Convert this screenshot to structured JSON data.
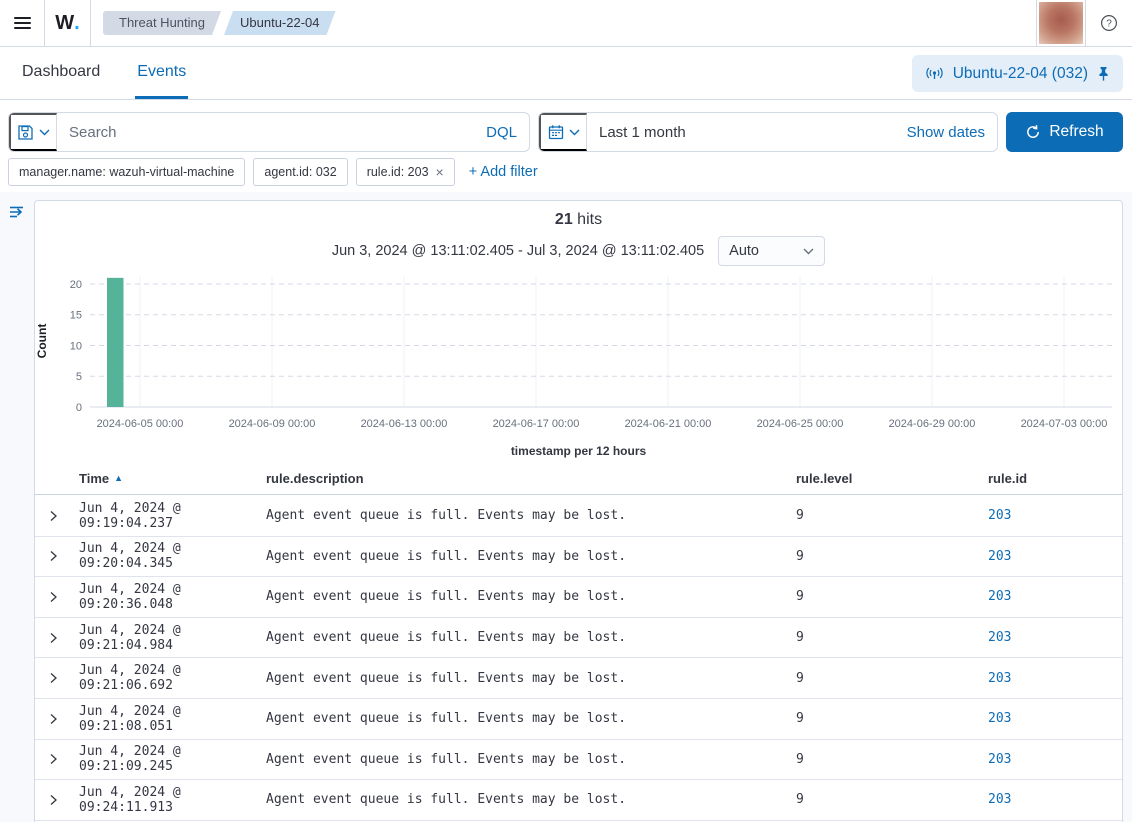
{
  "topbar": {
    "logo_text": "W",
    "logo_dot": ".",
    "breadcrumbs": [
      {
        "label": "Threat Hunting"
      },
      {
        "label": "Ubuntu-22-04"
      }
    ]
  },
  "tabs": [
    {
      "label": "Dashboard",
      "active": false
    },
    {
      "label": "Events",
      "active": true
    }
  ],
  "agent_chip": {
    "label": "Ubuntu-22-04 (032)"
  },
  "query_bar": {
    "search_placeholder": "Search",
    "search_value": "",
    "language_label": "DQL",
    "date_value": "Last 1 month",
    "show_dates_label": "Show dates",
    "refresh_label": "Refresh"
  },
  "filters": {
    "pills": [
      {
        "label": "manager.name: wazuh-virtual-machine",
        "close": ""
      },
      {
        "label": "agent.id: 032",
        "close": ""
      },
      {
        "label": "rule.id: 203",
        "close": "×"
      }
    ],
    "add_filter_label": "+ Add filter"
  },
  "hits": {
    "count": "21",
    "label": "hits"
  },
  "time_range": {
    "text": "Jun 3, 2024 @ 13:11:02.405 - Jul 3, 2024 @ 13:11:02.405",
    "interval_selected": "Auto"
  },
  "chart_data": {
    "type": "bar",
    "title": "21 hits",
    "xlabel": "timestamp per 12 hours",
    "ylabel": "Count",
    "y_ticks": [
      0,
      5,
      10,
      15,
      20
    ],
    "ylim": [
      0,
      21.3
    ],
    "x_ticks": [
      "2024-06-05 00:00",
      "2024-06-09 00:00",
      "2024-06-13 00:00",
      "2024-06-17 00:00",
      "2024-06-21 00:00",
      "2024-06-25 00:00",
      "2024-06-29 00:00",
      "2024-07-03 00:00"
    ],
    "x_range": [
      "2024-06-03 13:11",
      "2024-07-03 13:11"
    ],
    "bars": [
      {
        "bucket_start": "2024-06-04 00:00",
        "interval_hours": 12,
        "value": 21
      }
    ],
    "bar_color": "#54b399",
    "grid": true
  },
  "table": {
    "columns": {
      "time": "Time",
      "description": "rule.description",
      "level": "rule.level",
      "id": "rule.id"
    },
    "sort_icon": "▲",
    "rows": [
      {
        "time": "Jun 4, 2024 @ 09:19:04.237",
        "description": "Agent event queue is full. Events may be lost.",
        "level": "9",
        "rule_id": "203"
      },
      {
        "time": "Jun 4, 2024 @ 09:20:04.345",
        "description": "Agent event queue is full. Events may be lost.",
        "level": "9",
        "rule_id": "203"
      },
      {
        "time": "Jun 4, 2024 @ 09:20:36.048",
        "description": "Agent event queue is full. Events may be lost.",
        "level": "9",
        "rule_id": "203"
      },
      {
        "time": "Jun 4, 2024 @ 09:21:04.984",
        "description": "Agent event queue is full. Events may be lost.",
        "level": "9",
        "rule_id": "203"
      },
      {
        "time": "Jun 4, 2024 @ 09:21:06.692",
        "description": "Agent event queue is full. Events may be lost.",
        "level": "9",
        "rule_id": "203"
      },
      {
        "time": "Jun 4, 2024 @ 09:21:08.051",
        "description": "Agent event queue is full. Events may be lost.",
        "level": "9",
        "rule_id": "203"
      },
      {
        "time": "Jun 4, 2024 @ 09:21:09.245",
        "description": "Agent event queue is full. Events may be lost.",
        "level": "9",
        "rule_id": "203"
      },
      {
        "time": "Jun 4, 2024 @ 09:24:11.913",
        "description": "Agent event queue is full. Events may be lost.",
        "level": "9",
        "rule_id": "203"
      }
    ]
  },
  "colors": {
    "primary_blue": "#0d6cb6",
    "bar_teal": "#54b399",
    "border_gray": "#d3dae6",
    "text_dark": "#343741",
    "text_muted": "#69707d",
    "chip_bg": "#e4eef8"
  }
}
